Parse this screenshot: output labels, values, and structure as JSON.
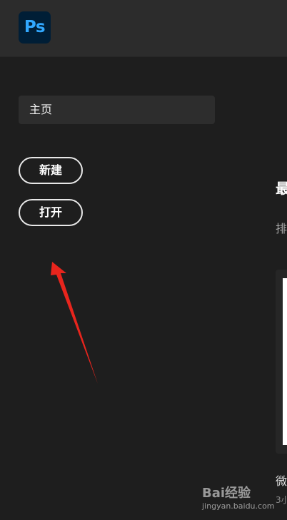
{
  "app": {
    "logo_text": "Ps"
  },
  "sidebar": {
    "home_label": "主页",
    "new_label": "新建",
    "open_label": "打开"
  },
  "main": {
    "recent_heading_partial": "最",
    "sort_label_partial": "排",
    "recent_files": [
      {
        "name_partial": "微",
        "time_partial": "3小"
      }
    ]
  },
  "watermark": {
    "line1": "Bai经验",
    "line2": "jingyan.baidu.com"
  },
  "colors": {
    "background": "#1e1e1e",
    "topbar": "#2c2c2c",
    "ps_logo_bg": "#001e36",
    "ps_logo_fg": "#31a8ff",
    "annotation_arrow": "#e8251d"
  }
}
